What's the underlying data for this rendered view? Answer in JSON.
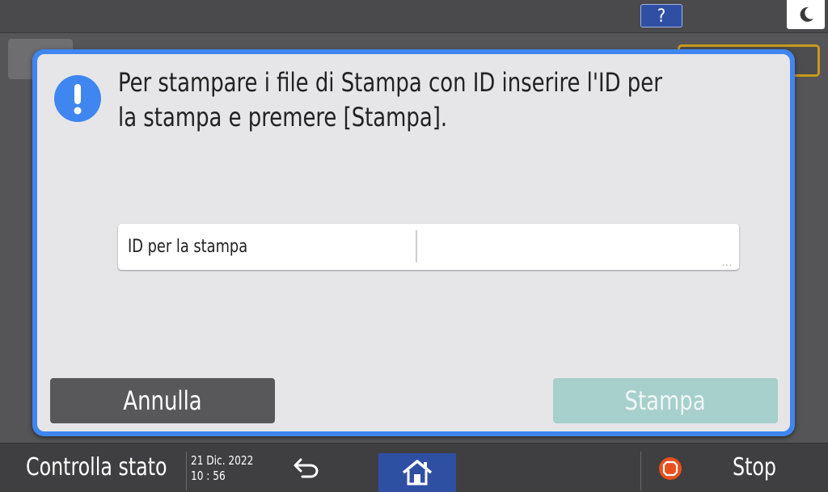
{
  "topbar": {
    "help_label": "?"
  },
  "icons": {
    "night": "moon-icon",
    "alert": "exclamation-icon",
    "back": "undo-arrow-icon",
    "home": "home-icon",
    "stop": "stop-icon"
  },
  "colors": {
    "dialog_border": "#3f86f0",
    "alert_icon": "#3f86f0",
    "cancel_bg": "#58585a",
    "print_bg_disabled": "#a7cfcc",
    "home_bg": "#2f4fa3",
    "stop_icon": "#e8501e"
  },
  "dialog": {
    "message": "Per stampare i file di Stampa con ID inserire l'ID per la stampa e premere [Stampa].",
    "field": {
      "label": "ID per la stampa",
      "value": "",
      "more": "..."
    },
    "cancel_label": "Annulla",
    "print_label": "Stampa",
    "print_enabled": false
  },
  "bottombar": {
    "status_label": "Controlla stato",
    "date": "21 Dic. 2022",
    "time": "10 : 56",
    "stop_label": "Stop"
  }
}
